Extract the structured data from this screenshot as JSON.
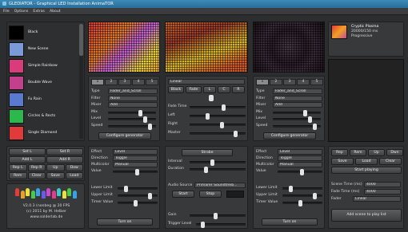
{
  "app": {
    "title": "GLEDIATOR - Graphical LED Installation AnimaTOR",
    "menu": [
      "File",
      "Options",
      "Extras",
      "About"
    ]
  },
  "animations": [
    "Black",
    "New Scene",
    "Simple Rainbow",
    "Bouble Wave",
    "Fu Rain",
    "Circles & Rects",
    "Single Diamond"
  ],
  "anim_colors": [
    "#000000",
    "#7a9bd8",
    "#d83c7a",
    "#c2408c",
    "#5a7ad0",
    "#2cb84c",
    "#e03a3a"
  ],
  "deck_a": {
    "tabs": [
      "1",
      "2",
      "3",
      "4",
      "5"
    ],
    "mix": "Fader_and_Scroll",
    "filter": "None",
    "mixer": "Add",
    "rows": [
      "Type",
      "Filter",
      "Mixer",
      "Mix",
      "Level",
      "Speed"
    ],
    "configure": "Configure generator"
  },
  "deck_b": {
    "tabs": [
      "1",
      "2",
      "3",
      "4",
      "5"
    ],
    "mix": "Fader_and_Scroll",
    "filter": "None",
    "mixer": "Add",
    "rows": [
      "Type",
      "Filter",
      "Mixer",
      "Mix",
      "Level",
      "Speed"
    ],
    "configure": "Configure generator"
  },
  "crossfader": {
    "mode": "Linear",
    "buttons": [
      "Black",
      "Fade",
      "L",
      "C",
      "R"
    ],
    "rows": [
      "Fade Time",
      "Left",
      "Right",
      "Master"
    ]
  },
  "scene_buttons": [
    [
      "Set L",
      "Set R"
    ],
    [
      "Add L",
      "Add R"
    ],
    [
      "Rep L",
      "Rep R",
      "Up",
      "Dow"
    ],
    [
      "Rem",
      "Clear",
      "Save",
      "Load"
    ]
  ],
  "logo": {
    "version": "V2.0.3 (nonbeg @ 20 FPS",
    "copyright": "(c) 2011 by M. Helber",
    "url": "www.solderlab.de"
  },
  "effect_left": {
    "rows": [
      "Effect",
      "Direction",
      "Multicolor",
      "Value"
    ],
    "values": [
      "Level",
      "Toggle",
      "Manual",
      ""
    ],
    "rows2": [
      "Lower Limit",
      "Upper Limit",
      "Timer Value"
    ],
    "turn_on": "Turn on"
  },
  "effect_right": {
    "rows": [
      "Effect",
      "Direction",
      "Multicolor",
      "Value"
    ],
    "values": [
      "Level",
      "Toggle",
      "Manual",
      ""
    ],
    "rows2": [
      "Lower Limit",
      "Upper Limit",
      "Timer Value"
    ],
    "turn_on": "Turn on"
  },
  "strobe": {
    "label": "Strobe",
    "rows": [
      "Interval",
      "Duration"
    ],
    "audio_label": "Audio Source",
    "audio_value": "Primärer Soundtreib...",
    "start": "Start",
    "stop": "Stop",
    "gain": "Gain",
    "trigger": "Trigger Level"
  },
  "playlist": {
    "buttons": [
      [
        "Rep",
        "Rem",
        "Up",
        "Dwn"
      ],
      [
        "Save",
        "Load",
        "Clear"
      ]
    ],
    "start": "Start playing",
    "rows": [
      "Scene Time (ms)",
      "Fade Time (ms)",
      "Fader"
    ],
    "scene_time": "4000",
    "fade_time": "4000",
    "fader": "Linear",
    "add_scene": "Add scene to play list"
  },
  "preview": {
    "name": "Cryptic Plasma",
    "size": "20000/150 ms",
    "mode": "Progressive"
  }
}
